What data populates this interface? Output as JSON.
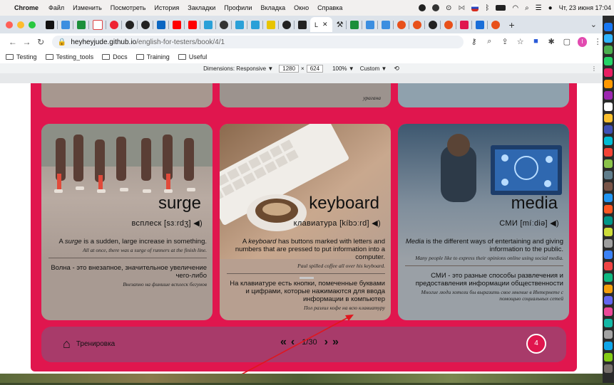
{
  "menubar": {
    "app_name": "Chrome",
    "items": [
      "Файл",
      "Изменить",
      "Посмотреть",
      "История",
      "Закладки",
      "Профили",
      "Вкладка",
      "Окно",
      "Справка"
    ],
    "clock": "Чт, 23 июня 17:04"
  },
  "tabstrip": {
    "active_tab_label": "L",
    "close_glyph": "✕",
    "new_tab_glyph": "+",
    "dropdown_glyph": "⌄"
  },
  "toolbar": {
    "url_host": "heyheyjude.github.io",
    "url_path": "/english-for-testers/book/4/1",
    "profile_initial": "I"
  },
  "bookmarks": [
    "Testing",
    "Testing_tools",
    "Docs",
    "Training",
    "Useful"
  ],
  "devtools": {
    "dimensions_label": "Dimensions: Responsive ▼",
    "width": "1280",
    "times": "×",
    "height": "624",
    "zoom": "100% ▼",
    "preset": "Custom ▼",
    "more": "⋮"
  },
  "top_partial": {
    "word_fragment": "урагана"
  },
  "cards": [
    {
      "word": "surge",
      "translation": "всплеск  [sɜːrdʒ]",
      "def_en_term": "surge",
      "def_en_rest": " is a sudden, large increase in something.",
      "def_en_prefix": "A ",
      "example_en": "All at once, there was a surge of runners at the finish line.",
      "def_ru": "Волна - это внезапное, значительное увеличение чего-либо",
      "example_ru": "Внезапно на финише всплеск бегунов"
    },
    {
      "word": "keyboard",
      "translation": "клавиатура  [kíbɔːrd]",
      "def_en_term": "keyboard",
      "def_en_rest": " has buttons marked with letters and numbers that are pressed to put information into a computer.",
      "def_en_prefix": "A ",
      "example_en": "Paul spilled coffee all over his keyboard.",
      "def_ru": "На клавиатуре есть кнопки, помеченные буквами и цифрами, которые нажимаются для ввода информации в компьютер",
      "example_ru": "Пол разлил кофе на всю клавиатуру"
    },
    {
      "word": "media",
      "translation": "СМИ  [míːdiə]",
      "def_en_term": "Media",
      "def_en_rest": " is the different ways of entertaining and giving information to the public.",
      "def_en_prefix": "",
      "example_en": "Many people like to express their opinions online using social media.",
      "def_ru": "СМИ - это разные способы развлечения и предоставления информации общественности",
      "example_ru": "Многие люди хотели бы выразить свое мнение в Интернете с помощью социальных сетей"
    }
  ],
  "bottom_bar": {
    "home_label": "Тренировка",
    "first_glyph": "«",
    "prev_glyph": "‹",
    "page": "1/30",
    "next_glyph": "›",
    "last_glyph": "»",
    "badge_count": "4"
  },
  "colors": {
    "panel": "#e0164e",
    "card": "#a89a92",
    "badge": "#e0164e",
    "arrow": "#e0161e"
  }
}
